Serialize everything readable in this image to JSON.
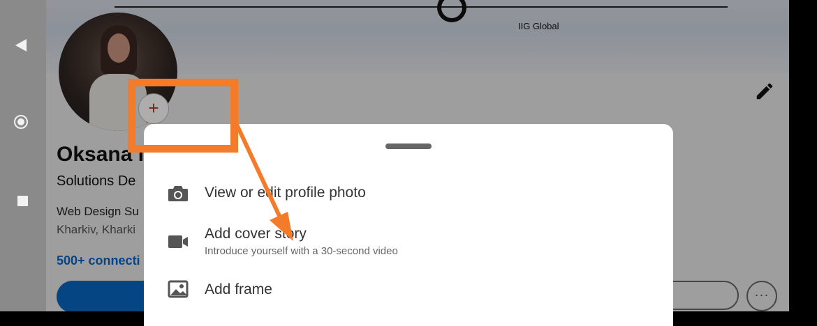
{
  "system_nav": {
    "back_icon": "back-triangle-icon",
    "home_icon": "home-circle-icon",
    "recents_icon": "recents-square-icon"
  },
  "profile": {
    "cover_company": "IIG Global",
    "name": "Oksana I",
    "headline": "Solutions De",
    "company": "Web Design Su",
    "location": "Kharkiv, Kharki",
    "connections": "500+ connecti",
    "add_photo_symbol": "+",
    "more_symbol": "···"
  },
  "sheet": {
    "items": [
      {
        "label": "View or edit profile photo",
        "icon": "camera-icon"
      },
      {
        "label": "Add cover story",
        "sublabel": "Introduce yourself with a 30-second video",
        "icon": "video-camera-icon"
      },
      {
        "label": "Add frame",
        "icon": "image-icon"
      }
    ]
  },
  "annotation": {
    "color": "#f47b2a"
  },
  "colors": {
    "brand_blue": "#0a66c2",
    "accent_orange": "#f47b2a"
  }
}
